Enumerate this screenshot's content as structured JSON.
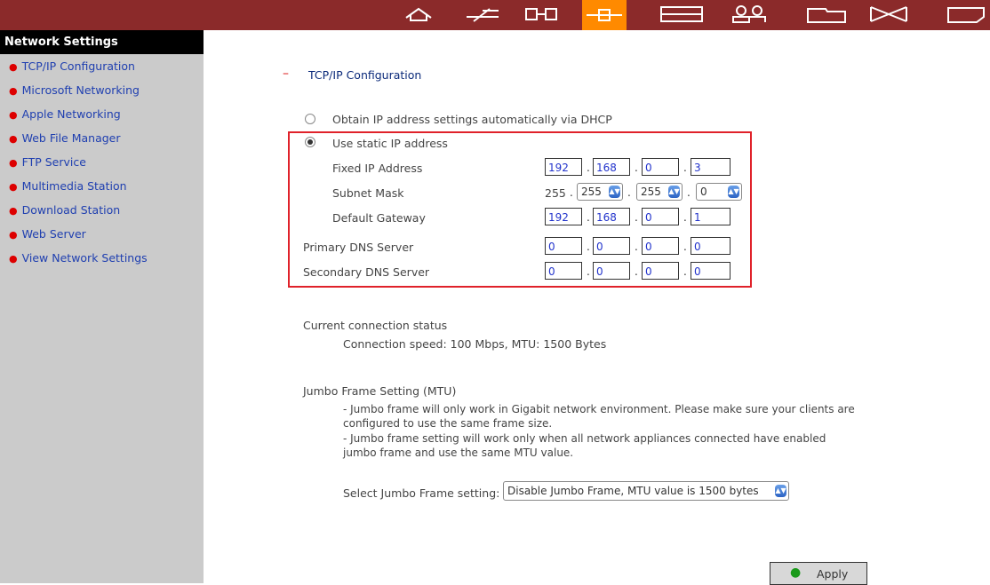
{
  "toolbar": {
    "icons": [
      "home-icon",
      "quick-config-icon",
      "system-tools-icon",
      "network-icon",
      "devices-icon",
      "users-icon",
      "share-folder-icon",
      "application-icon",
      "logout-icon"
    ],
    "active_index": 3,
    "bar_color": "#8b2a2a",
    "active_color": "#ff8a00"
  },
  "sidebar": {
    "title": "Network Settings",
    "items": [
      {
        "label": "TCP/IP Configuration"
      },
      {
        "label": "Microsoft Networking"
      },
      {
        "label": "Apple Networking"
      },
      {
        "label": "Web File Manager"
      },
      {
        "label": "FTP Service"
      },
      {
        "label": "Multimedia Station"
      },
      {
        "label": "Download Station"
      },
      {
        "label": "Web Server"
      },
      {
        "label": "View Network Settings"
      }
    ]
  },
  "main": {
    "section_title": "TCP/IP Configuration",
    "section_toggle": "–",
    "dhcp_label": "Obtain IP address settings automatically via DHCP",
    "static_label": "Use static IP address",
    "static_selected": true,
    "fixed_ip": {
      "label": "Fixed IP Address",
      "octets": [
        "192",
        "168",
        "0",
        "3"
      ]
    },
    "subnet": {
      "label": "Subnet Mask",
      "fixed_octet": "255",
      "selects": [
        "255",
        "255",
        "0"
      ]
    },
    "gateway": {
      "label": "Default Gateway",
      "octets": [
        "192",
        "168",
        "0",
        "1"
      ]
    },
    "dns_primary": {
      "label": "Primary DNS Server",
      "octets": [
        "0",
        "0",
        "0",
        "0"
      ]
    },
    "dns_secondary": {
      "label": "Secondary DNS Server",
      "octets": [
        "0",
        "0",
        "0",
        "0"
      ]
    },
    "octet_separator": ".",
    "status_heading": "Current connection status",
    "status_text": "Connection speed: 100 Mbps, MTU: 1500 Bytes",
    "jumbo_heading": "Jumbo Frame Setting (MTU)",
    "jumbo_note_1a": "- Jumbo frame will only work in Gigabit network environment. Please make sure your clients are",
    "jumbo_note_1b": "configured to use the same frame size.",
    "jumbo_note_2a": "- Jumbo frame setting will work only when all network appliances connected have enabled",
    "jumbo_note_2b": "jumbo frame and use the same MTU value.",
    "jumbo_select_label": "Select Jumbo Frame setting:",
    "jumbo_select_value": "Disable Jumbo Frame, MTU value is 1500 bytes",
    "apply_label": "Apply"
  },
  "colors": {
    "highlight_border": "#e0222a",
    "link": "#1f3fb0",
    "bullet": "#dd0000"
  }
}
